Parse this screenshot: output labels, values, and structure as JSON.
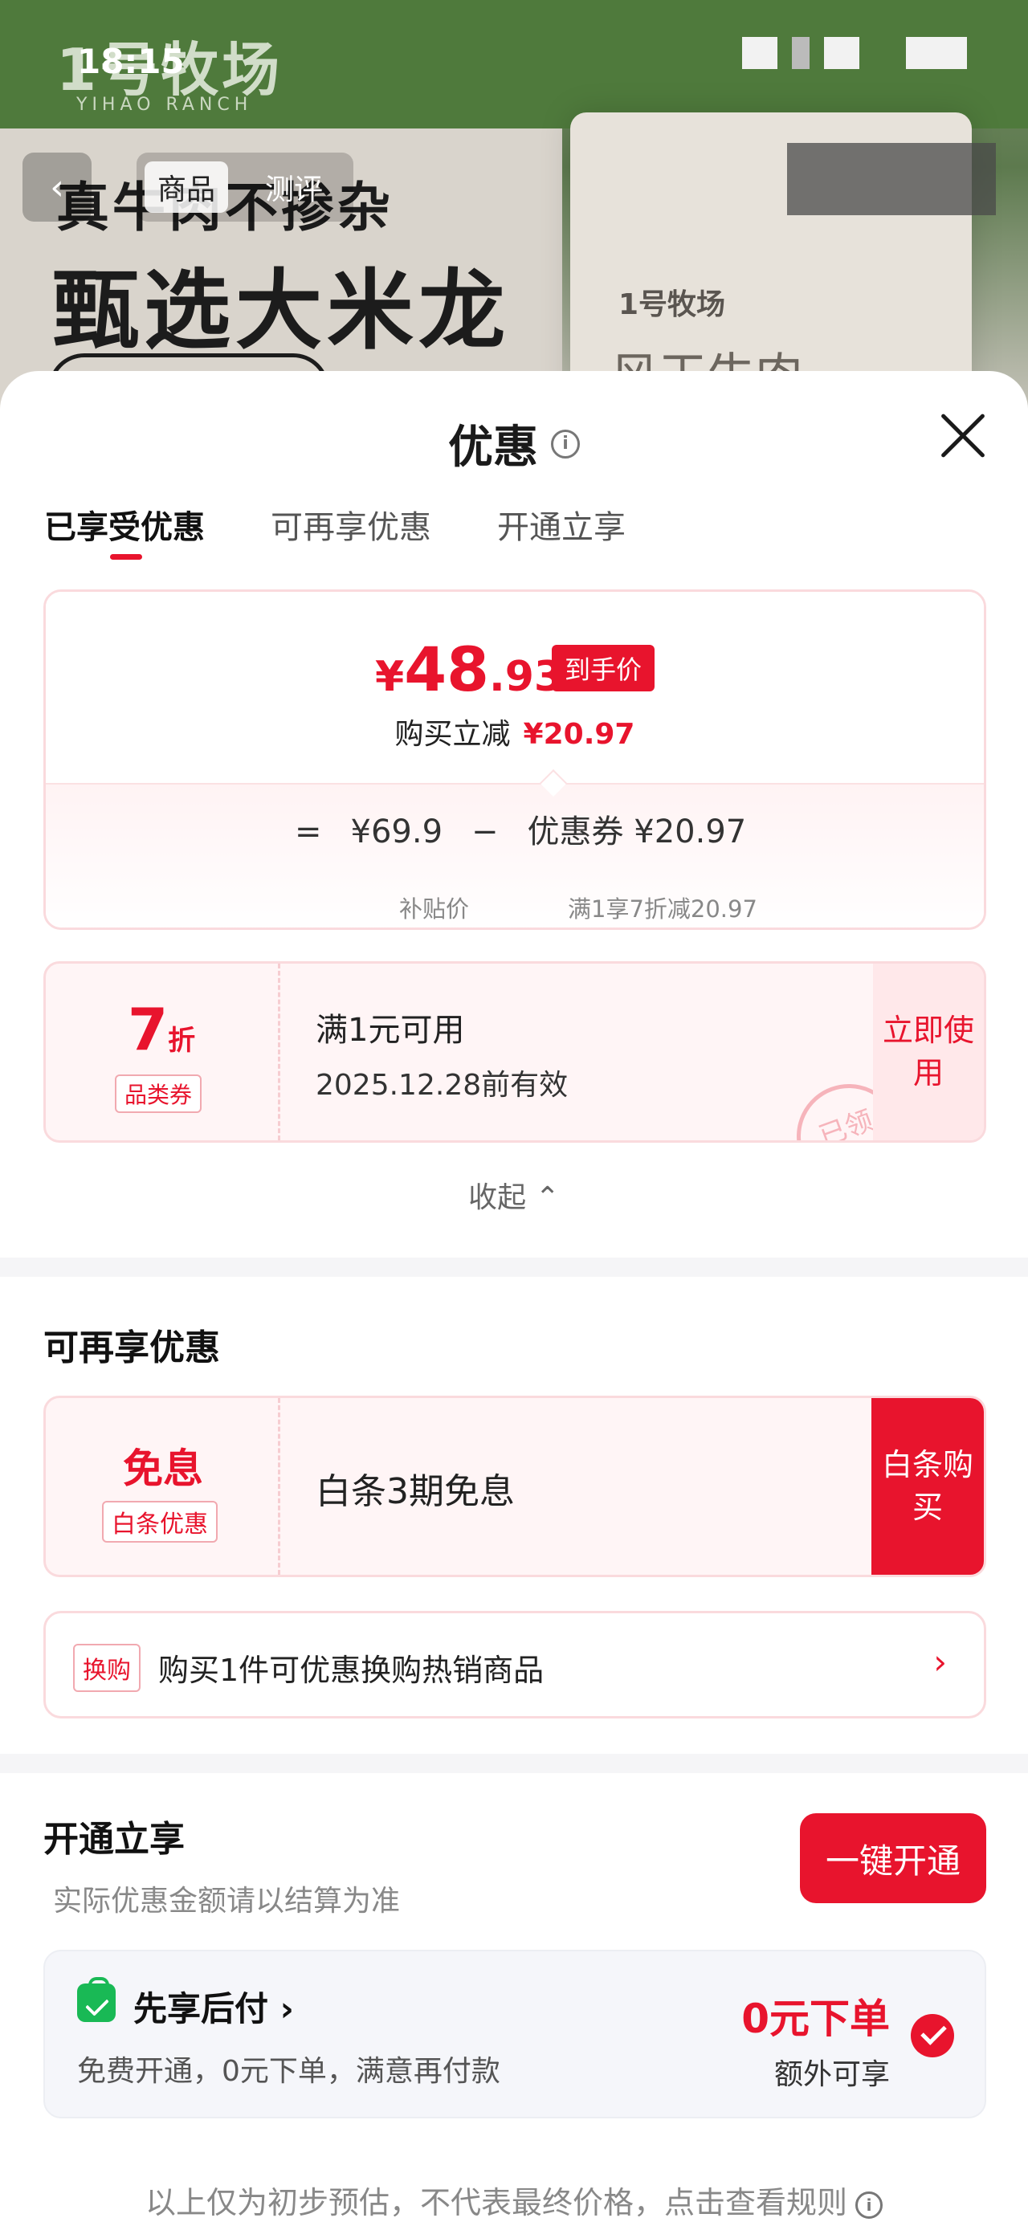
{
  "status_bar": {
    "time": "18:15"
  },
  "background": {
    "brand_logo": "1号牧场",
    "brand_sub": "YIHAO RANCH",
    "headline_line1": "真牛肉不掺杂",
    "headline_line2": "甄选大米龙",
    "bag_logo": "1号牧场",
    "bag_text": "风干牛肉",
    "nav_tabs": [
      "商品",
      "测评"
    ]
  },
  "sheet": {
    "title": "优惠",
    "tabs": [
      "已享受优惠",
      "可再享优惠",
      "开通立享"
    ],
    "active_tab": 0
  },
  "price_card": {
    "currency": "¥",
    "final_int": "48",
    "final_dec": ".93",
    "final_tag": "到手价",
    "reduce_label": "购买立减",
    "reduce_amount": "¥20.97",
    "eq": "=",
    "subsidy_price": "¥69.9",
    "minus": "−",
    "coupon_label": "优惠券 ¥20.97",
    "subsidy_caption": "补贴价",
    "coupon_caption": "满1享7折减20.97"
  },
  "coupon": {
    "discount_value": "7",
    "discount_unit": "折",
    "category_tag": "品类券",
    "condition": "满1元可用",
    "validity": "2025.12.28前有效",
    "action": "立即使用",
    "stamp": "已领"
  },
  "collapse_label": "收起",
  "more_section": {
    "title": "可再享优惠",
    "baitiao": {
      "name": "免息",
      "tag": "白条优惠",
      "desc": "白条3期免息",
      "action": "白条购买"
    },
    "swap": {
      "tag": "换购",
      "text": "购买1件可优惠换购热销商品"
    }
  },
  "open_section": {
    "title": "开通立享",
    "subtitle": "实际优惠金额请以结算为准",
    "button": "一键开通",
    "pay_later": {
      "title": "先享后付",
      "desc": "免费开通，0元下单，满意再付款",
      "big": "0元下单",
      "small": "额外可享"
    }
  },
  "footer_note": "以上仅为初步预估，不代表最终价格，点击查看规则",
  "colors": {
    "accent": "#e8142d",
    "green": "#19b955"
  }
}
